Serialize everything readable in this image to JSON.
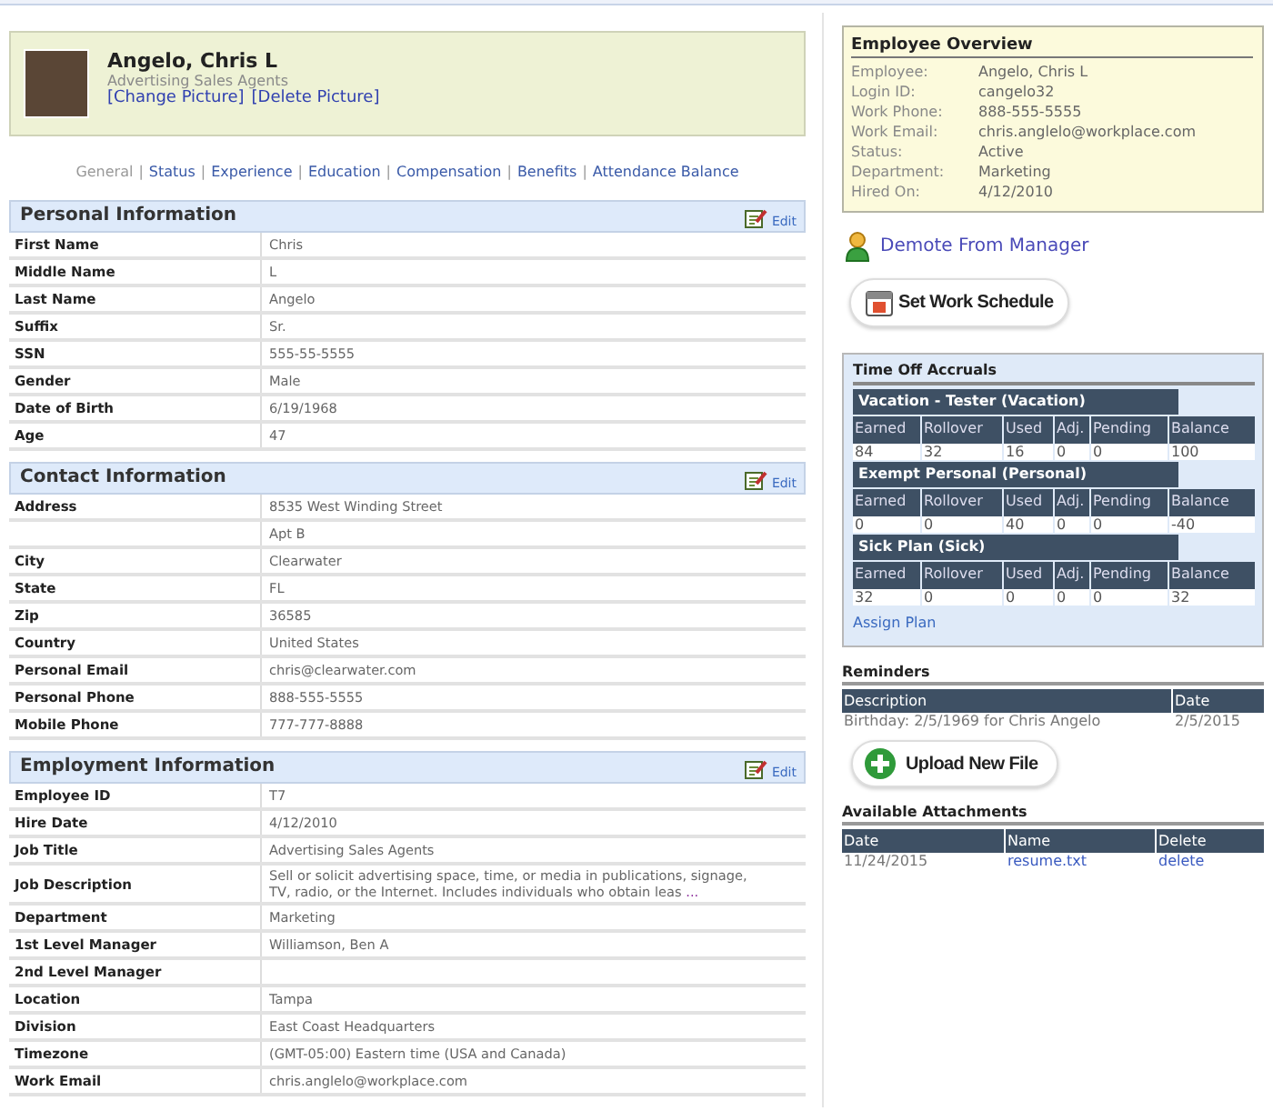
{
  "profile": {
    "name": "Angelo, Chris L",
    "title": "Advertising Sales Agents",
    "links": [
      "[Change Picture]",
      "[Delete Picture]"
    ]
  },
  "tab_separator": "|",
  "tabs": [
    {
      "label": "General",
      "selected": true
    },
    {
      "label": "Status",
      "selected": false
    },
    {
      "label": "Experience",
      "selected": false
    },
    {
      "label": "Education",
      "selected": false
    },
    {
      "label": "Compensation",
      "selected": false
    },
    {
      "label": "Benefits",
      "selected": false
    },
    {
      "label": "Attendance Balance",
      "selected": false
    }
  ],
  "sections": [
    {
      "title": "Personal Information",
      "edit": "Edit",
      "rows": [
        {
          "label": "First Name",
          "value": "Chris"
        },
        {
          "label": "Middle Name",
          "value": "L"
        },
        {
          "label": "Last Name",
          "value": "Angelo"
        },
        {
          "label": "Suffix",
          "value": "Sr."
        },
        {
          "label": "SSN",
          "value": "555-55-5555"
        },
        {
          "label": "Gender",
          "value": "Male"
        },
        {
          "label": "Date of Birth",
          "value": "6/19/1968"
        },
        {
          "label": "Age",
          "value": "47"
        }
      ]
    },
    {
      "title": "Contact Information",
      "edit": "Edit",
      "rows": [
        {
          "label": "Address",
          "value": "8535 West Winding Street"
        },
        {
          "value": "Apt B"
        },
        {
          "label": "City",
          "value": "Clearwater"
        },
        {
          "label": "State",
          "value": "FL"
        },
        {
          "label": "Zip",
          "value": "36585"
        },
        {
          "label": "Country",
          "value": "United States"
        },
        {
          "label": "Personal Email",
          "value": "chris@clearwater.com"
        },
        {
          "label": "Personal Phone",
          "value": "888-555-5555"
        },
        {
          "label": "Mobile Phone",
          "value": "777-777-8888"
        }
      ]
    },
    {
      "title": "Employment Information",
      "edit": "Edit",
      "rows": [
        {
          "label": "Employee ID",
          "value": "T7"
        },
        {
          "label": "Hire Date",
          "value": "4/12/2010"
        },
        {
          "label": "Job Title",
          "value": "Advertising Sales Agents"
        },
        {
          "label": "Job Description",
          "value": "Sell or solicit advertising space, time, or media in publications, signage, TV, radio, or the Internet. Includes individuals who obtain leas",
          "more": "..."
        },
        {
          "label": "Department",
          "value": "Marketing"
        },
        {
          "label": "1st Level Manager",
          "value": "Williamson, Ben A"
        },
        {
          "label": "2nd Level Manager"
        },
        {
          "label": "Location",
          "value": "Tampa"
        },
        {
          "label": "Division",
          "value": "East Coast Headquarters"
        },
        {
          "label": "Timezone",
          "value": "(GMT-05:00) Eastern time (USA and Canada)"
        },
        {
          "label": "Work Email",
          "value": "chris.anglelo@workplace.com"
        }
      ]
    }
  ],
  "overview": {
    "title": "Employee Overview",
    "rows": [
      {
        "label": "Employee:",
        "value": "Angelo, Chris L"
      },
      {
        "label": "Login ID:",
        "value": "cangelo32"
      },
      {
        "label": "Work Phone:",
        "value": "888-555-5555"
      },
      {
        "label": "Work Email:",
        "value": "chris.anglelo@workplace.com"
      },
      {
        "label": "Status:",
        "value": "Active"
      },
      {
        "label": "Department:",
        "value": "Marketing"
      },
      {
        "label": "Hired On:",
        "value": "4/12/2010"
      }
    ]
  },
  "demote_link": "Demote From Manager",
  "schedule_button": "Set Work Schedule",
  "time_off": {
    "title": "Time Off Accruals",
    "plans": [
      {
        "name": "Vacation - Tester (Vacation)",
        "columns": [
          "Earned",
          "Rollover",
          "Used",
          "Adj.",
          "Pending",
          "Balance"
        ],
        "values": [
          "84",
          "32",
          "16",
          "0",
          "0",
          "100"
        ]
      },
      {
        "name": "Exempt Personal (Personal)",
        "columns": [
          "Earned",
          "Rollover",
          "Used",
          "Adj.",
          "Pending",
          "Balance"
        ],
        "values": [
          "0",
          "0",
          "40",
          "0",
          "0",
          "-40"
        ]
      },
      {
        "name": "Sick Plan (Sick)",
        "columns": [
          "Earned",
          "Rollover",
          "Used",
          "Adj.",
          "Pending",
          "Balance"
        ],
        "values": [
          "32",
          "0",
          "0",
          "0",
          "0",
          "32"
        ]
      }
    ],
    "assign_link": "Assign Plan"
  },
  "reminders": {
    "title": "Reminders",
    "columns": [
      "Description",
      "Date"
    ],
    "rows": [
      [
        "Birthday: 2/5/1969 for Chris Angelo",
        "2/5/2015"
      ]
    ]
  },
  "upload_button": "Upload New File",
  "attachments": {
    "title": "Available Attachments",
    "columns": [
      "Date",
      "Name",
      "Delete"
    ],
    "rows": [
      {
        "date": "11/24/2015",
        "name": "resume.txt",
        "delete": "delete"
      }
    ]
  }
}
